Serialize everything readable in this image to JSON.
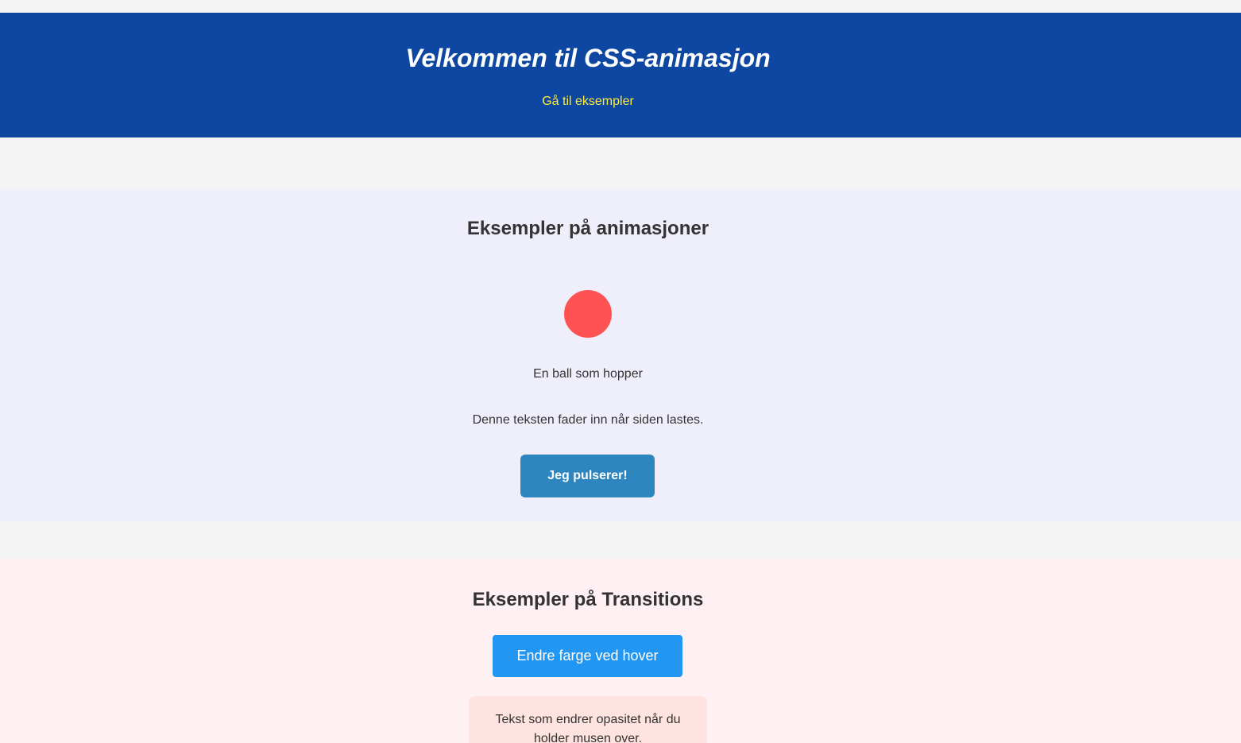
{
  "header": {
    "title": "Velkommen til CSS-animasjon",
    "nav_link": "Gå til eksempler"
  },
  "animations": {
    "title": "Eksempler på animasjoner",
    "ball_caption": "En ball som hopper",
    "fade_text": "Denne teksten fader inn når siden lastes.",
    "pulse_button": "Jeg pulserer!"
  },
  "transitions": {
    "title": "Eksempler på Transitions",
    "hover_button": "Endre farge ved hover",
    "opacity_text": "Tekst som endrer opasitet når du holder musen over."
  },
  "colors": {
    "header_bg": "#0d47a1",
    "link": "#ffeb3b",
    "ball": "#ff5252",
    "pulse_button": "#2e86c1",
    "hover_button": "#2196f3"
  }
}
